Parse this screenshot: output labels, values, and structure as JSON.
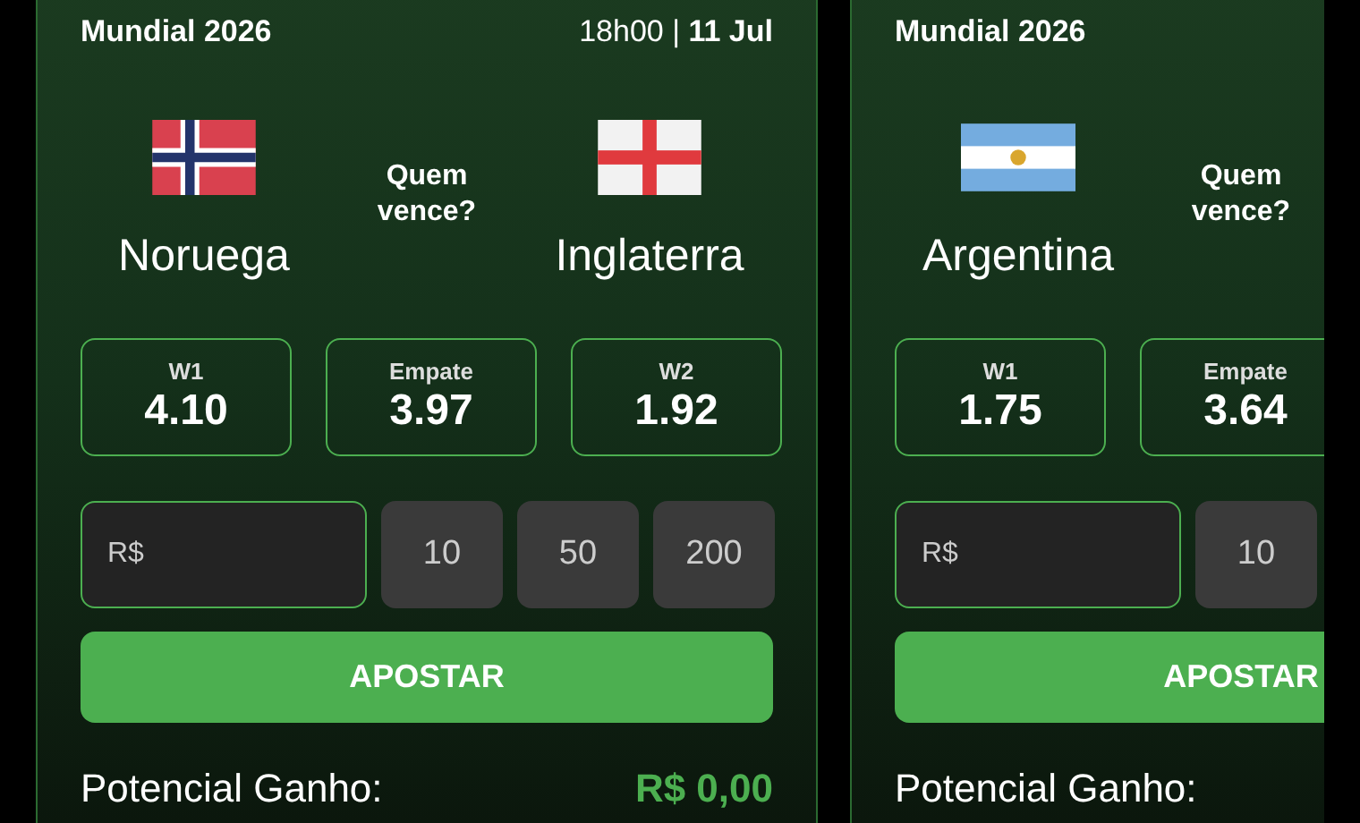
{
  "cards": [
    {
      "title": "Mundial 2026",
      "datetime": "18h00 | **11 Jul**",
      "team1": {
        "name": "Noruega",
        "kind": "norway"
      },
      "question": "Quem vence?",
      "team2": {
        "name": "Inglaterra",
        "kind": "england"
      },
      "odds": [
        {
          "label": "W1",
          "value": "4.10"
        },
        {
          "label": "Empate",
          "value": "3.97"
        },
        {
          "label": "W2",
          "value": "1.92"
        }
      ],
      "stake": {
        "placeholder": "R$"
      },
      "amounts": [
        "10",
        "50",
        "200"
      ],
      "bet_button": "APOSTAR",
      "payout_label": "Potencial Ganho:",
      "payout_value": "R$ 0,00"
    },
    {
      "title": "Mundial 2026",
      "team1": {
        "name": "Argentina",
        "kind": "argentina"
      },
      "question": "Quem vence?",
      "odds": [
        {
          "label": "W1",
          "value": "1.75"
        },
        {
          "label": "Empate",
          "value": "3.64"
        }
      ],
      "stake": {
        "placeholder": "R$"
      },
      "amounts": [
        "10"
      ],
      "bet_button": "APOSTAR",
      "payout_label": "Potencial Ganho:"
    }
  ]
}
